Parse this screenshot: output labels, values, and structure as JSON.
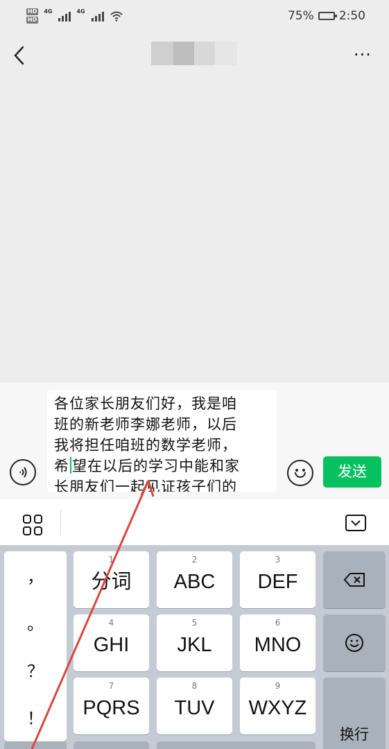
{
  "status_bar": {
    "left_indicators": [
      "HD",
      "HD"
    ],
    "network_1": "4G",
    "network_2": "4G",
    "battery_percent": "75%",
    "battery_level": 0.75,
    "time": "2:50"
  },
  "header": {
    "back_icon": "chevron-left-icon",
    "more_icon": "more-dots-icon",
    "more_label": "···"
  },
  "composer": {
    "voice_icon": "voice-input-icon",
    "message_lines": [
      "各位家长朋友们好，我是咱",
      "班的新老师李娜老师，以后",
      "我将担任咱班的数学老师，",
      "希",
      "望在以后的学习中能和家",
      "长朋友们一起见证孩子们的"
    ],
    "emoji_icon": "smile-icon",
    "send_label": "发送"
  },
  "keyboard": {
    "toolbar_left_icon": "grid-icon",
    "toolbar_right_icon": "keyboard-collapse-icon",
    "punctuation": [
      "，",
      "。",
      "？",
      "！"
    ],
    "keys": [
      {
        "num": "1",
        "label": "分词"
      },
      {
        "num": "2",
        "label": "ABC"
      },
      {
        "num": "3",
        "label": "DEF"
      },
      {
        "num": "4",
        "label": "GHI"
      },
      {
        "num": "5",
        "label": "JKL"
      },
      {
        "num": "6",
        "label": "MNO"
      },
      {
        "num": "7",
        "label": "PQRS"
      },
      {
        "num": "8",
        "label": "TUV"
      },
      {
        "num": "9",
        "label": "WXYZ"
      }
    ],
    "backspace_icon": "backspace-icon",
    "emoji_key_icon": "emoji-icon",
    "enter_label": "换行"
  },
  "colors": {
    "send_green": "#07c160",
    "annotation_red": "#d9463f"
  }
}
